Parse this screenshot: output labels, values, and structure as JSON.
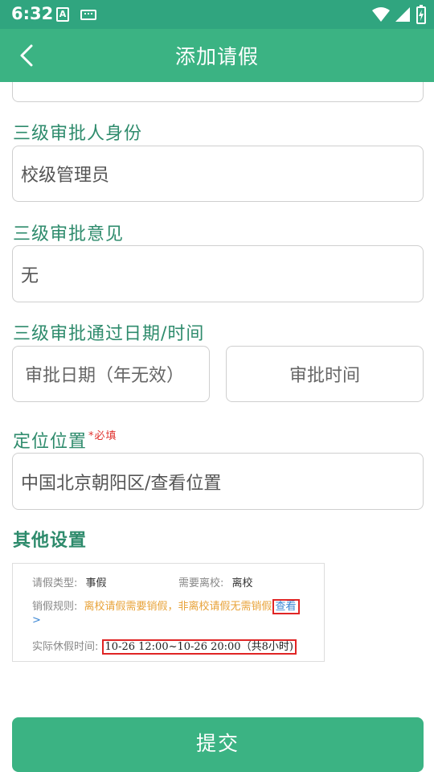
{
  "status_bar": {
    "time": "6:32",
    "notification_letter": "A",
    "icons": [
      "a-notification-icon",
      "keyboard-icon",
      "wifi-icon",
      "signal-icon",
      "battery-icon"
    ]
  },
  "toolbar": {
    "title": "添加请假",
    "back_icon": "chevron-left-icon"
  },
  "form": {
    "level3_role_label": "三级审批人身份",
    "level3_role_value": "校级管理员",
    "level3_opinion_label": "三级审批意见",
    "level3_opinion_value": "无",
    "level3_pass_label": "三级审批通过日期/时间",
    "level3_date_placeholder": "审批日期（年无效）",
    "level3_time_placeholder": "审批时间",
    "location_label": "定位位置",
    "location_required": "*必填",
    "location_value": "中国北京朝阳区/查看位置"
  },
  "other_settings": {
    "title": "其他设置",
    "leave_type_label": "请假类型:",
    "leave_type_value": "事假",
    "leave_school_label": "需要离校:",
    "leave_school_value": "离校",
    "cancel_rule_label": "销假规则:",
    "cancel_rule_value": "离校请假需要销假，非离校请假无需销假",
    "cancel_rule_link": "查看",
    "cancel_rule_arrow": ">",
    "actual_time_label": "实际休假时间:",
    "actual_time_value": "10-26 12:00~10-26 20:00（共8小时)"
  },
  "submit_label": "提交",
  "colors": {
    "primary": "#3bb383",
    "status_bar": "#30a57f",
    "label_text": "#2e8b6c",
    "required": "#e0332f",
    "highlight_border": "#e02525",
    "orange_text": "#e8a33a",
    "link": "#3a86d4"
  }
}
